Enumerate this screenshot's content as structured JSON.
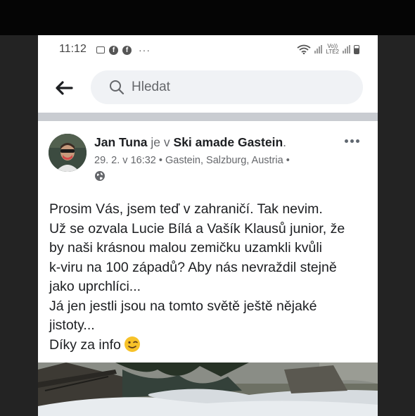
{
  "status_bar": {
    "time": "11:12",
    "left_icons": [
      "image-icon",
      "facebook-icon",
      "facebook-icon"
    ],
    "more": "···",
    "volte": "Vo))",
    "lte": "LTE2"
  },
  "header": {
    "search_placeholder": "Hledat"
  },
  "post": {
    "author": "Jan Tuna",
    "connector": "je v",
    "place": "Ski amade Gastein",
    "place_suffix": ".",
    "date": "29. 2. v 16:32",
    "location": "Gastein, Salzburg, Austria",
    "meta_separator": " • ",
    "privacy": "public",
    "lines": [
      "Prosim Vás, jsem teď v zahraničí. Tak nevim.",
      "Už se ozvala Lucie Bílá a Vašík Klausů junior, že",
      "by naši krásnou malou zemičku uzamkli kvůli",
      "k-viru na 100 západů? Aby nás nevraždil stejně",
      "jako uprchlíci...",
      "Já jen jestli jsou na tomto světě ještě nějaké",
      "jistoty...",
      "Díky za info"
    ],
    "emoji": "winking-face"
  }
}
